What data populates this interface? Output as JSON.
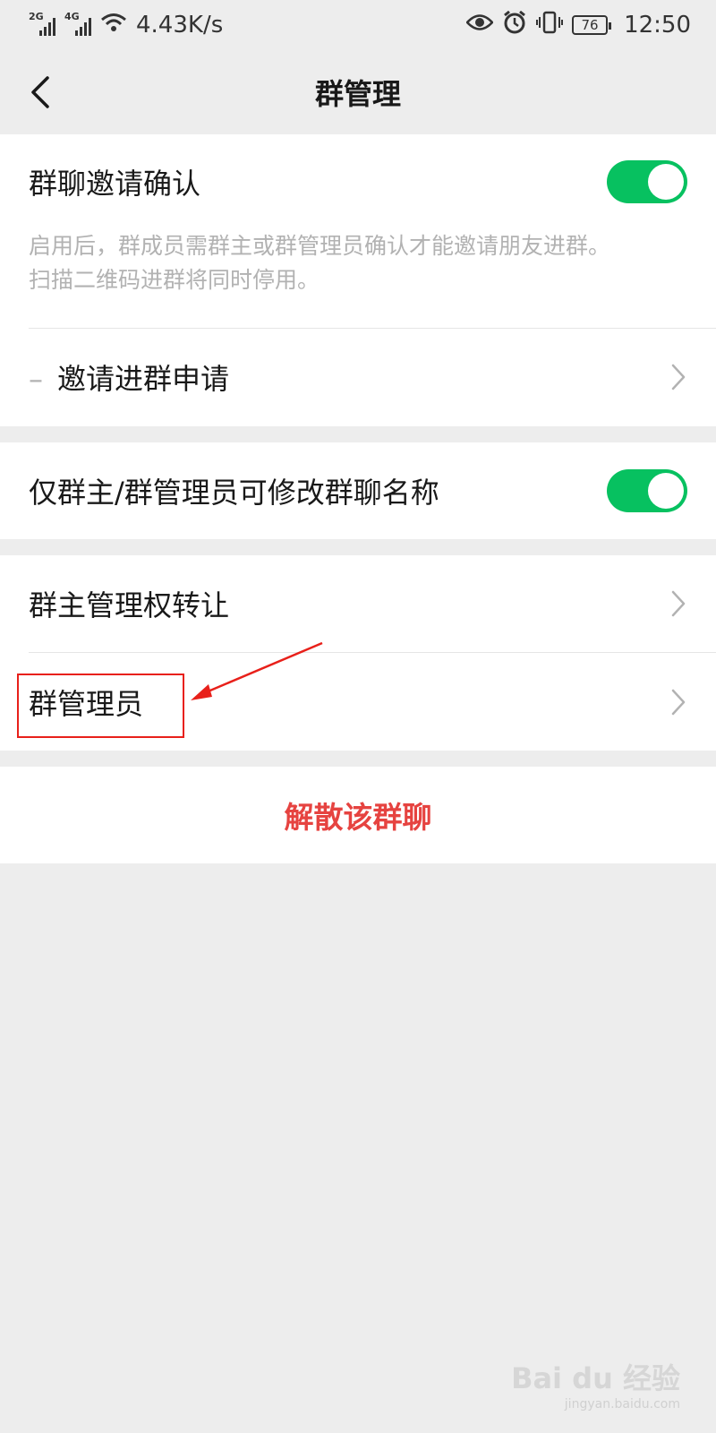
{
  "status_bar": {
    "net_1": "2G",
    "net_2": "4G",
    "speed": "4.43K/s",
    "battery": "76",
    "time": "12:50"
  },
  "navbar": {
    "title": "群管理"
  },
  "settings": {
    "invite_confirm": {
      "label": "群聊邀请确认",
      "enabled": true,
      "description_line1": "启用后，群成员需群主或群管理员确认才能邀请朋友进群。",
      "description_line2": "扫描二维码进群将同时停用。"
    },
    "invite_requests": {
      "dash": "–",
      "label": "邀请进群申请"
    },
    "only_admin_rename": {
      "label": "仅群主/群管理员可修改群聊名称",
      "enabled": true
    },
    "transfer_owner": {
      "label": "群主管理权转让"
    },
    "admins": {
      "label": "群管理员"
    },
    "dismiss": {
      "label": "解散该群聊"
    }
  },
  "colors": {
    "accent_green": "#07c160",
    "danger_red": "#e64340",
    "annotation_red": "#e8201a"
  },
  "watermark": {
    "main": "Bai du 经验",
    "sub": "jingyan.baidu.com"
  }
}
